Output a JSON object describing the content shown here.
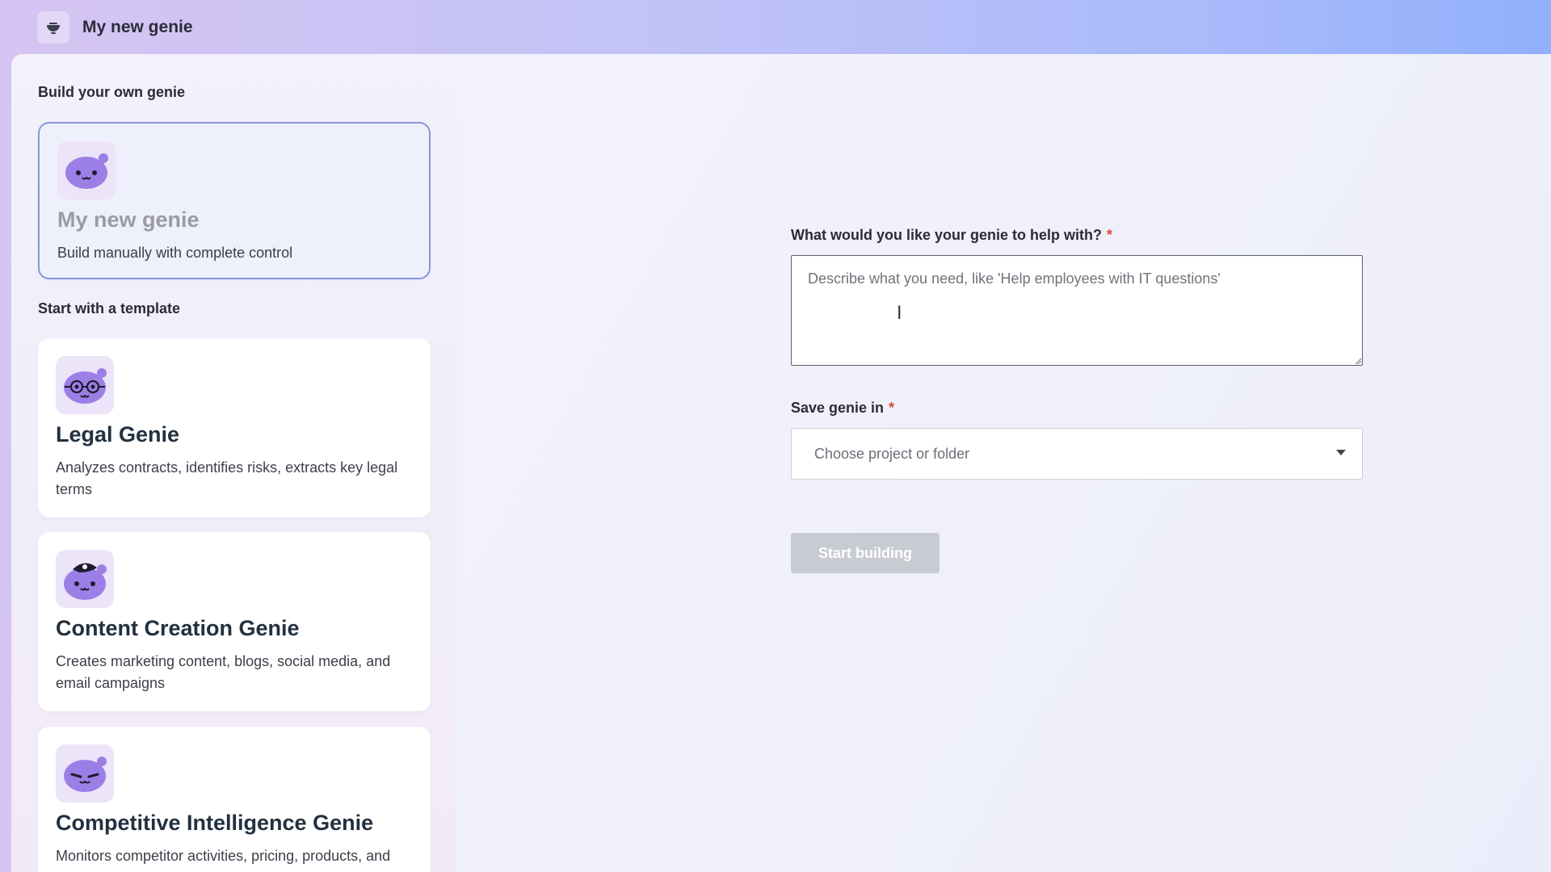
{
  "header": {
    "title": "My new genie",
    "icon": "genie-lamp-icon"
  },
  "sidebar": {
    "build_heading": "Build your own genie",
    "template_heading": "Start with a template",
    "custom_card": {
      "title": "My new genie",
      "description": "Build manually with complete control",
      "icon": "genie-face-icon"
    },
    "templates": [
      {
        "title": "Legal Genie",
        "description": "Analyzes contracts, identifies risks, extracts key legal terms",
        "icon": "genie-glasses-icon"
      },
      {
        "title": "Content Creation Genie",
        "description": "Creates marketing content, blogs, social media, and email campaigns",
        "icon": "genie-beret-icon"
      },
      {
        "title": "Competitive Intelligence Genie",
        "description": "Monitors competitor activities, pricing, products, and",
        "icon": "genie-sly-icon"
      }
    ]
  },
  "form": {
    "purpose_label": "What would you like your genie to help with?",
    "purpose_placeholder": "Describe what you need, like 'Help employees with IT questions'",
    "purpose_value": "",
    "save_label": "Save genie in",
    "required_mark": "*",
    "save_placeholder": "Choose project or folder",
    "start_button": "Start building"
  },
  "colors": {
    "accent_border": "#8797dc",
    "required": "#e0433b",
    "button_disabled": "#c9cbd3",
    "icon_purple": "#9b7fe6"
  }
}
